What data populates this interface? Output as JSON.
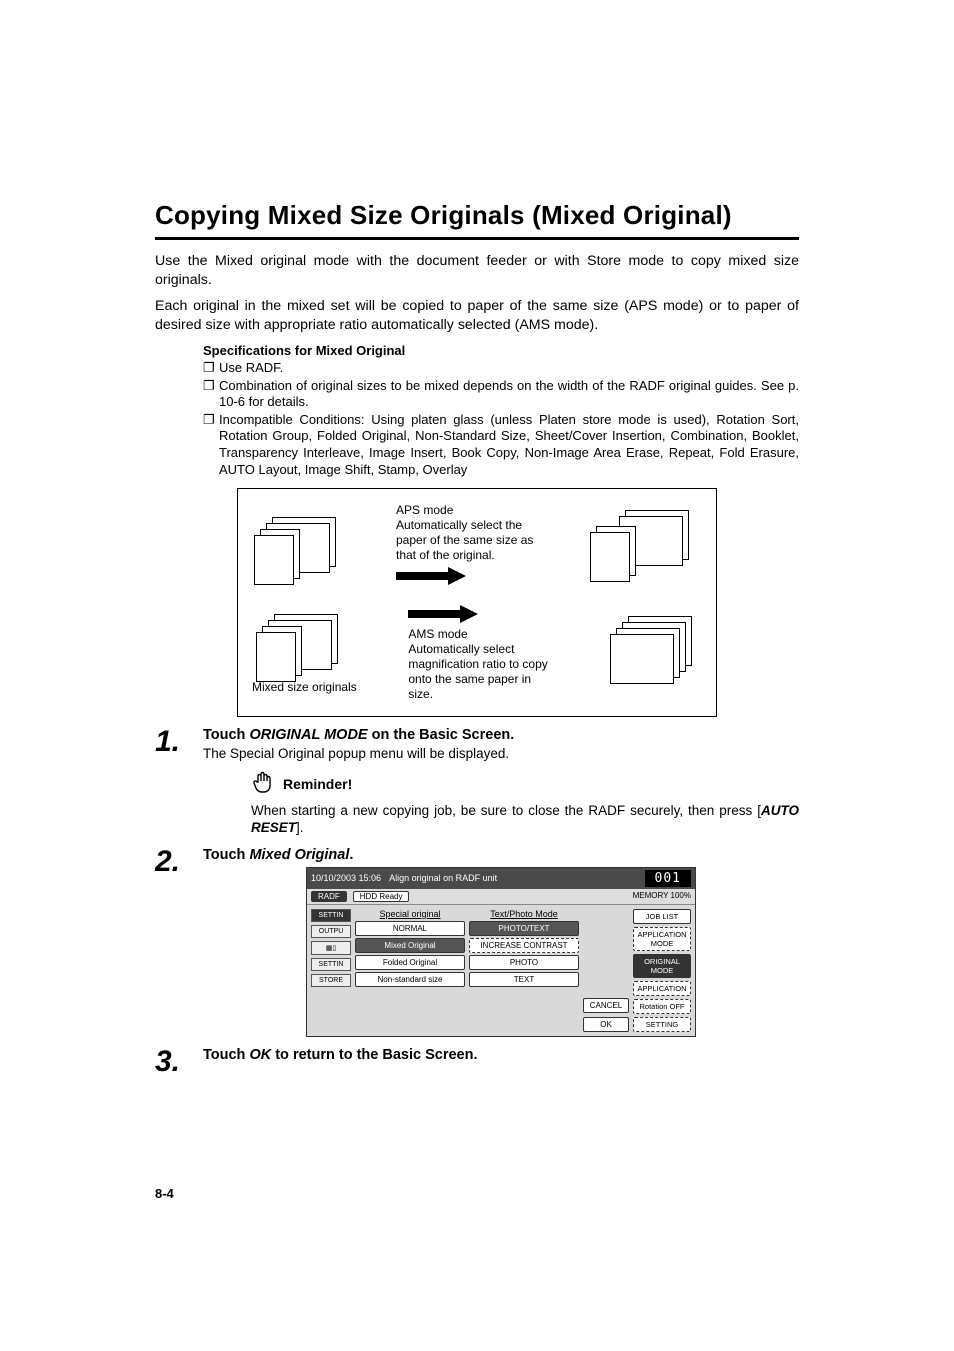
{
  "heading": "Copying Mixed Size Originals (Mixed Original)",
  "intro1": "Use the Mixed original mode with the document feeder or with Store mode to copy mixed size originals.",
  "intro2": "Each original in the mixed set will be copied to paper of the same size (APS mode) or to paper of desired size with appropriate ratio automatically selected (AMS mode).",
  "spec_heading": "Specifications for Mixed Original",
  "bullets": {
    "b1": "Use RADF.",
    "b2": "Combination of original sizes to be mixed depends on the width of the RADF original guides. See p. 10-6 for details.",
    "b3": "Incompatible Conditions: Using platen glass (unless Platen store mode is used), Rotation Sort, Rotation Group, Folded Original, Non-Standard Size, Sheet/Cover Insertion, Combination, Booklet, Transparency Interleave, Image Insert, Book Copy, Non-Image Area Erase, Repeat, Fold Erasure, AUTO Layout, Image Shift, Stamp, Overlay"
  },
  "diagram": {
    "left_label": "Mixed size originals",
    "aps_mode": "APS mode",
    "aps_text": "Automatically select the paper of the same size as that of the original.",
    "ams_mode": "AMS mode",
    "ams_text": "Automatically select magnification ratio to copy onto the same paper in size."
  },
  "steps": {
    "s1_num": "1.",
    "s1_title_a": "Touch ",
    "s1_title_b": "ORIGINAL MODE",
    "s1_title_c": " on the Basic Screen.",
    "s1_text": "The Special Original popup menu will be displayed.",
    "s2_num": "2.",
    "s2_title_a": "Touch ",
    "s2_title_b": "Mixed Original",
    "s2_title_c": ".",
    "s3_num": "3.",
    "s3_title_a": "Touch ",
    "s3_title_b": "OK",
    "s3_title_c": " to return to the Basic Screen."
  },
  "reminder": {
    "label": "Reminder!",
    "text_a": "When starting a new copying job, be sure to close the RADF securely, then press [",
    "text_b": "AUTO RESET",
    "text_c": "]."
  },
  "ui": {
    "datetime": "10/10/2003 15:06",
    "status": "Align original on RADF unit",
    "counter": "001",
    "memory": "MEMORY 100%",
    "radf": "RADF",
    "hdd": "HDD Ready",
    "settin": "SETTIN",
    "outpu": "OUTPU",
    "store": "STORE",
    "scanner": "—",
    "special_original": "Special original",
    "normal": "NORMAL",
    "mixed_original": "Mixed Original",
    "folded_original": "Folded Original",
    "nonstandard": "Non-standard size",
    "textphoto_mode": "Text/Photo Mode",
    "photo_text": "PHOTO/TEXT",
    "increase_contrast": "INCREASE CONTRAST",
    "photo": "PHOTO",
    "text": "TEXT",
    "cancel": "CANCEL",
    "ok": "OK",
    "job_list": "JOB LIST",
    "application_mode": "APPLICATION MODE",
    "original_mode": "ORIGINAL MODE",
    "application": "APPLICATION",
    "rotation_off": "Rotation OFF",
    "setting": "SETTING"
  },
  "page_num": "8-4"
}
